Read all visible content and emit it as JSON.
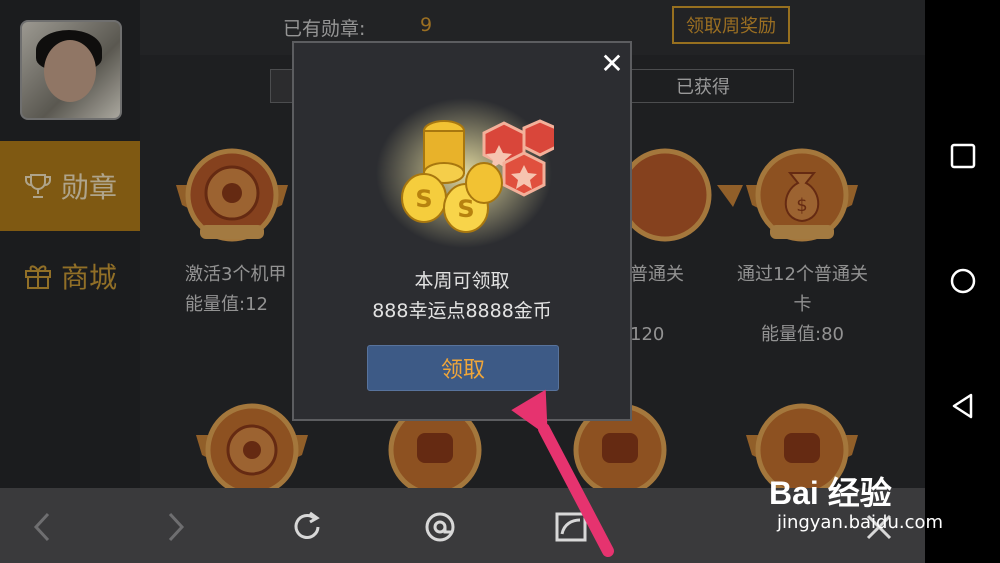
{
  "header": {
    "medal_count_label": "已有勋章:",
    "medal_count_value": "9",
    "weekly_reward_button": "领取周奖励"
  },
  "tabs": [
    {
      "label": ""
    },
    {
      "label": "已获得"
    }
  ],
  "sidebar": {
    "items": [
      {
        "label": "勋章",
        "icon": "trophy-icon",
        "active": true
      },
      {
        "label": "商城",
        "icon": "gift-icon",
        "active": false
      }
    ]
  },
  "medals": [
    {
      "title": "激活3个机甲",
      "value": "能量值:12"
    },
    {
      "title": "普通关",
      "value": "120"
    },
    {
      "title_line1": "通过12个普通关",
      "title_line2": "卡",
      "value": "能量值:80"
    }
  ],
  "dialog": {
    "line1": "本周可领取",
    "line2": "888幸运点8888金币",
    "claim_button": "领取",
    "close_symbol": "✕"
  },
  "watermark": {
    "logo_text": "Bai 经验",
    "url": "jingyan.baidu.com"
  },
  "colors": {
    "accent_gold": "#d79a30",
    "active_sidebar": "#b07c1a",
    "claim_button_bg": "#3d5a86",
    "arrow": "#e6336f"
  }
}
